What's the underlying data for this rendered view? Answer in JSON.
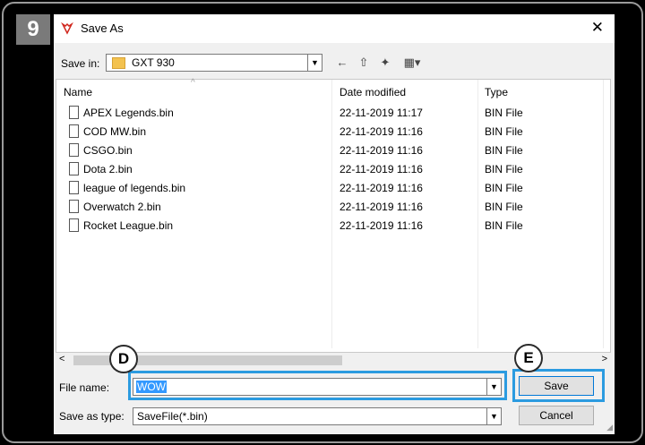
{
  "step_number": "9",
  "window": {
    "title": "Save As",
    "close_glyph": "✕",
    "icon": "app-logo-icon"
  },
  "toolbar": {
    "save_in_label": "Save in:",
    "save_in_value": "GXT 930",
    "dropdown_glyph": "▼",
    "back_glyph": "←",
    "up_glyph": "⇧",
    "new_folder_glyph": "✦",
    "view_menu_glyph": "▦▾"
  },
  "filelist": {
    "sort_glyph": "^",
    "columns": {
      "name": "Name",
      "date": "Date modified",
      "type": "Type"
    },
    "rows": [
      {
        "name": "APEX Legends.bin",
        "date": "22-11-2019 11:17",
        "type": "BIN File"
      },
      {
        "name": "COD MW.bin",
        "date": "22-11-2019 11:16",
        "type": "BIN File"
      },
      {
        "name": "CSGO.bin",
        "date": "22-11-2019 11:16",
        "type": "BIN File"
      },
      {
        "name": "Dota 2.bin",
        "date": "22-11-2019 11:16",
        "type": "BIN File"
      },
      {
        "name": "league of legends.bin",
        "date": "22-11-2019 11:16",
        "type": "BIN File"
      },
      {
        "name": "Overwatch 2.bin",
        "date": "22-11-2019 11:16",
        "type": "BIN File"
      },
      {
        "name": "Rocket League.bin",
        "date": "22-11-2019 11:16",
        "type": "BIN File"
      }
    ]
  },
  "scroll": {
    "left_glyph": "<",
    "right_glyph": ">"
  },
  "form": {
    "file_name_label": "File name:",
    "file_name_value": "WOW",
    "save_as_type_label": "Save as type:",
    "save_as_type_value": "SaveFile(*.bin)"
  },
  "buttons": {
    "save": "Save",
    "cancel": "Cancel"
  },
  "callouts": {
    "d": "D",
    "e": "E"
  },
  "colors": {
    "highlight": "#2b9be0",
    "selection": "#3399ff"
  }
}
